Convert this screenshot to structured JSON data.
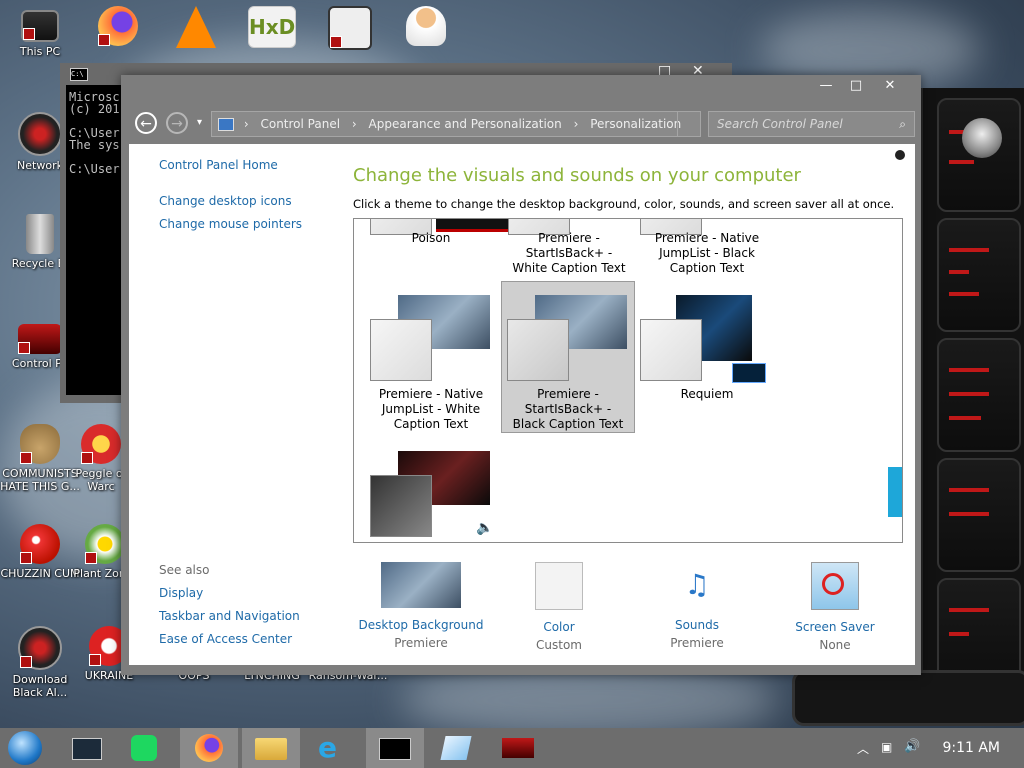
{
  "desktop": {
    "icons": [
      {
        "label": "This PC",
        "icon": "monitor-icon"
      },
      {
        "label": "",
        "icon": "firefox-icon"
      },
      {
        "label": "",
        "icon": "vlc-icon"
      },
      {
        "label": "",
        "icon": "hxd-icon"
      },
      {
        "label": "",
        "icon": "maze-app-icon"
      },
      {
        "label": "",
        "icon": "doctor-icon"
      },
      {
        "label": "Network",
        "icon": "network-icon"
      },
      {
        "label": "Recycle Bi",
        "icon": "recycle-bin-icon"
      },
      {
        "label": "Control Pa",
        "icon": "control-panel-icon"
      },
      {
        "label": "COMMUNISTS HATE THIS G...",
        "icon": "money-bag-icon"
      },
      {
        "label": "Peggle of Warc",
        "icon": "peggle-icon"
      },
      {
        "label": "CHUZZIN CUM",
        "icon": "chuzzle-icon"
      },
      {
        "label": "Plant Zomb",
        "icon": "plants-icon"
      },
      {
        "label": "Download Black Al...",
        "icon": "alienware-icon"
      },
      {
        "label": "UKRAINE",
        "icon": "shield-app-icon"
      },
      {
        "label": "OOPS",
        "icon": "blank-icon"
      },
      {
        "label": "LYNCHING",
        "icon": "blank-icon"
      },
      {
        "label": "Ransom-War...",
        "icon": "blank-icon"
      }
    ]
  },
  "cmd_window": {
    "icon_text": "C:\\",
    "lines": [
      "Microsc",
      "(c) 201",
      "",
      "C:\\User",
      "The sys",
      "",
      "C:\\User"
    ]
  },
  "control_panel": {
    "breadcrumb": [
      "Control Panel",
      "Appearance and Personalization",
      "Personalization"
    ],
    "search_placeholder": "Search Control Panel",
    "sidebar": {
      "home": "Control Panel Home",
      "links": [
        "Change desktop icons",
        "Change mouse pointers"
      ],
      "see_also_title": "See also",
      "see_also": [
        "Display",
        "Taskbar and Navigation",
        "Ease of Access Center"
      ]
    },
    "heading": "Change the visuals and sounds on your computer",
    "subheading": "Click a theme to change the desktop background, color, sounds, and screen saver all at once.",
    "themes": [
      {
        "name": "Poison",
        "selected": false
      },
      {
        "name": "Premiere - StartIsBack+ - White Caption Text",
        "selected": false
      },
      {
        "name": "Premiere - Native JumpList - Black Caption Text",
        "selected": false
      },
      {
        "name": "Premiere - Native JumpList - White Caption Text",
        "selected": false
      },
      {
        "name": "Premiere - StartIsBack+ - Black Caption Text",
        "selected": true
      },
      {
        "name": "Requiem",
        "selected": false
      },
      {
        "name": "",
        "selected": false
      }
    ],
    "bottom": [
      {
        "name": "Desktop Background",
        "value": "Premiere",
        "icon": "desktop-background-icon"
      },
      {
        "name": "Color",
        "value": "Custom",
        "icon": "color-swatch-icon"
      },
      {
        "name": "Sounds",
        "value": "Premiere",
        "icon": "music-notes-icon"
      },
      {
        "name": "Screen Saver",
        "value": "None",
        "icon": "screen-saver-icon"
      }
    ]
  },
  "taskbar": {
    "clock": "9:11 AM",
    "apps": [
      "start-orb-icon",
      "task-view-icon",
      "spotify-icon",
      "firefox-icon",
      "file-explorer-icon",
      "internet-explorer-icon",
      "cmd-icon",
      "notepad-icon",
      "alienware-icon"
    ]
  },
  "colors": {
    "heading": "#8db43a",
    "link": "#1e6aa8",
    "scroll_accent": "#1ea7d9",
    "widget_red": "#c01818"
  }
}
